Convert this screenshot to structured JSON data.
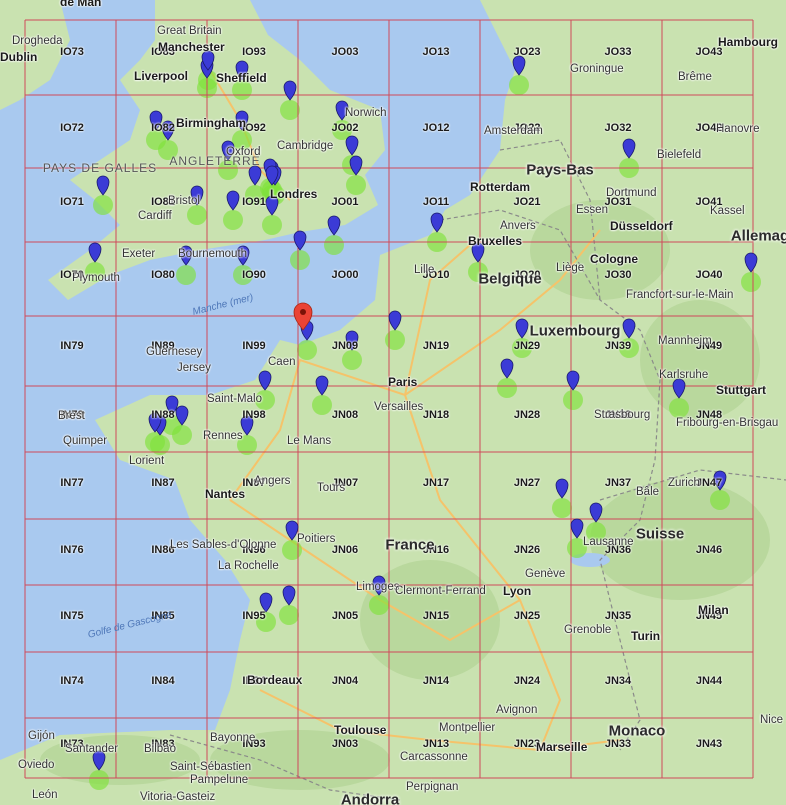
{
  "grid_labels": [
    "IO73",
    "IO83",
    "IO93",
    "JO03",
    "JO13",
    "JO23",
    "JO33",
    "JO43",
    "IO72",
    "IO82",
    "IO92",
    "JO02",
    "JO12",
    "JO22",
    "JO32",
    "JO42",
    "IO71",
    "IO81",
    "IO91",
    "JO01",
    "JO11",
    "JO21",
    "JO31",
    "JO41",
    "IO70",
    "IO80",
    "IO90",
    "JO00",
    "JO10",
    "JO20",
    "JO30",
    "JO40",
    "IN79",
    "IN89",
    "IN99",
    "JN09",
    "JN19",
    "JN29",
    "JN39",
    "JN49",
    "IN78",
    "IN88",
    "IN98",
    "JN08",
    "JN18",
    "JN28",
    "JN38",
    "JN48",
    "IN77",
    "IN87",
    "IN97",
    "JN07",
    "JN17",
    "JN27",
    "JN37",
    "JN47",
    "IN76",
    "IN86",
    "IN96",
    "JN06",
    "JN16",
    "JN26",
    "JN36",
    "JN46",
    "IN75",
    "IN85",
    "IN95",
    "JN05",
    "JN15",
    "JN25",
    "JN35",
    "JN45",
    "IN74",
    "IN84",
    "IN94",
    "JN04",
    "JN14",
    "JN24",
    "JN34",
    "JN44",
    "IN73",
    "IN83",
    "IN93",
    "JN03",
    "JN13",
    "JN23",
    "JN33",
    "JN43"
  ],
  "country_labels": [
    "Pays-Bas",
    "Belgique",
    "Luxembourg",
    "France",
    "Suisse",
    "Allemag",
    "Monaco",
    "Andorra"
  ],
  "region_labels": [
    "PAYS DE GALLES",
    "ANGLETERRE"
  ],
  "sea_labels": [
    "Manche (mer)",
    "Golfe de Gascogne"
  ],
  "city_labels": [
    "Dublin",
    "Drogheda",
    "Great Britain",
    "Manchester",
    "Liverpool",
    "Sheffield",
    "Norwich",
    "Birmingham",
    "Cambridge",
    "Oxford",
    "Londres",
    "Bristol",
    "Cardiff",
    "Exeter",
    "Bournemouth",
    "Plymouth",
    "Amsterdam",
    "Groningue",
    "Brême",
    "Hambourg",
    "Hanovre",
    "Bielefeld",
    "Dortmund",
    "Essen",
    "Düsseldorf",
    "Rotterdam",
    "Anvers",
    "Bruxelles",
    "Lille",
    "Liège",
    "Cologne",
    "Kassel",
    "Francfort-sur-le-Main",
    "Mannheim",
    "Karlsruhe",
    "Stuttgart",
    "Fribourg-en-Brisgau",
    "Zurich",
    "Bâle",
    "Strasbourg",
    "Paris",
    "Versailles",
    "Caen",
    "Guernesey",
    "Jersey",
    "Saint-Malo",
    "Brest",
    "Quimper",
    "Lorient",
    "Rennes",
    "Le Mans",
    "Nantes",
    "Angers",
    "Tours",
    "Poitiers",
    "Les Sables-d'Olonne",
    "La Rochelle",
    "Limoges",
    "Clermont-Ferrand",
    "Lyon",
    "Genève",
    "Lausanne",
    "Grenoble",
    "Turin",
    "Milan",
    "Bordeaux",
    "Toulouse",
    "Montpellier",
    "Marseille",
    "Avignon",
    "Carcassonne",
    "Perpignan",
    "Bayonne",
    "Bilbao",
    "Santander",
    "Oviedo",
    "Gijón",
    "Saint-Sébastien",
    "Pampelune",
    "Vitoria-Gasteiz",
    "León",
    "Nice"
  ],
  "markers": {
    "count": 54,
    "colors": {
      "blue_pin": "#3b3bd6",
      "red_pin": "#ea4335",
      "heat": "#7fe23a",
      "grid": "#d0495a",
      "water": "#a9c9ef",
      "land": "#c9e2b0"
    }
  },
  "top_partial_label": "de Man"
}
